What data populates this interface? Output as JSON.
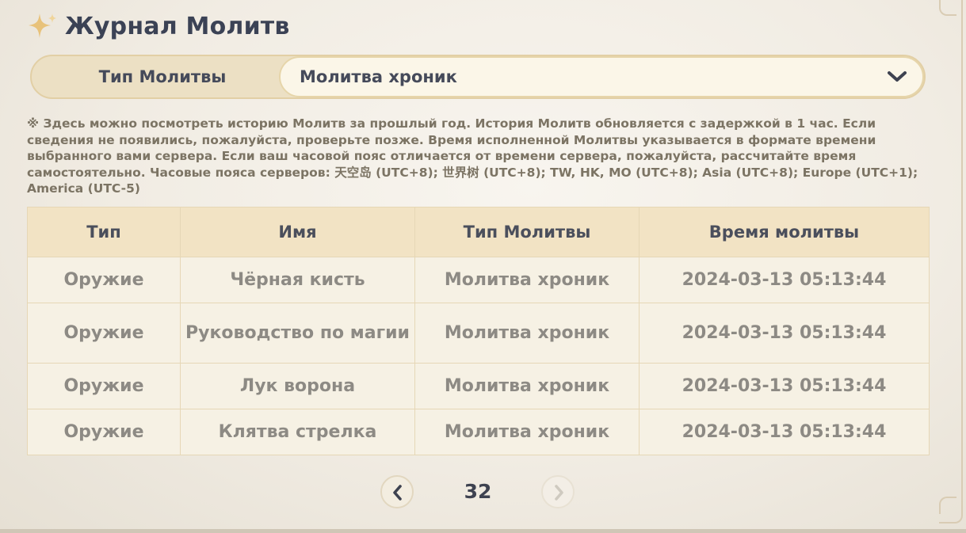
{
  "header": {
    "title": "Журнал Молитв",
    "icon": "sparkle-star-icon"
  },
  "selector": {
    "label": "Тип Молитвы",
    "selected": "Молитва хроник",
    "icon": "chevron-down-icon"
  },
  "notice": "※ Здесь можно посмотреть историю Молитв за прошлый год. История Молитв обновляется с задержкой в 1 час. Если сведения не появились, пожалуйста, проверьте позже. Время исполненной Молитвы указывается в формате времени выбранного вами сервера. Если ваш часовой пояс отличается от времени сервера, пожалуйста, рассчитайте время самостоятельно. Часовые пояса серверов: 天空岛 (UTC+8); 世界树 (UTC+8); TW, HK, MO (UTC+8); Asia (UTC+8); Europe (UTC+1); America (UTC-5)",
  "table": {
    "columns": [
      "Тип",
      "Имя",
      "Тип Молитвы",
      "Время молитвы"
    ],
    "rows": [
      [
        "Оружие",
        "Чёрная кисть",
        "Молитва хроник",
        "2024-03-13 05:13:44"
      ],
      [
        "Оружие",
        "Руководство по магии",
        "Молитва хроник",
        "2024-03-13 05:13:44"
      ],
      [
        "Оружие",
        "Лук ворона",
        "Молитва хроник",
        "2024-03-13 05:13:44"
      ],
      [
        "Оружие",
        "Клятва стрелка",
        "Молитва хроник",
        "2024-03-13 05:13:44"
      ]
    ]
  },
  "pagination": {
    "page": "32",
    "prev_icon": "chevron-left-icon",
    "next_icon": "chevron-right-icon"
  },
  "colors": {
    "title": "#3b4255",
    "header_bg": "#f2e3c4",
    "cell_bg": "#f6f1e4",
    "cell_text": "#8d8a84",
    "accent_star": "#e8c27a"
  }
}
